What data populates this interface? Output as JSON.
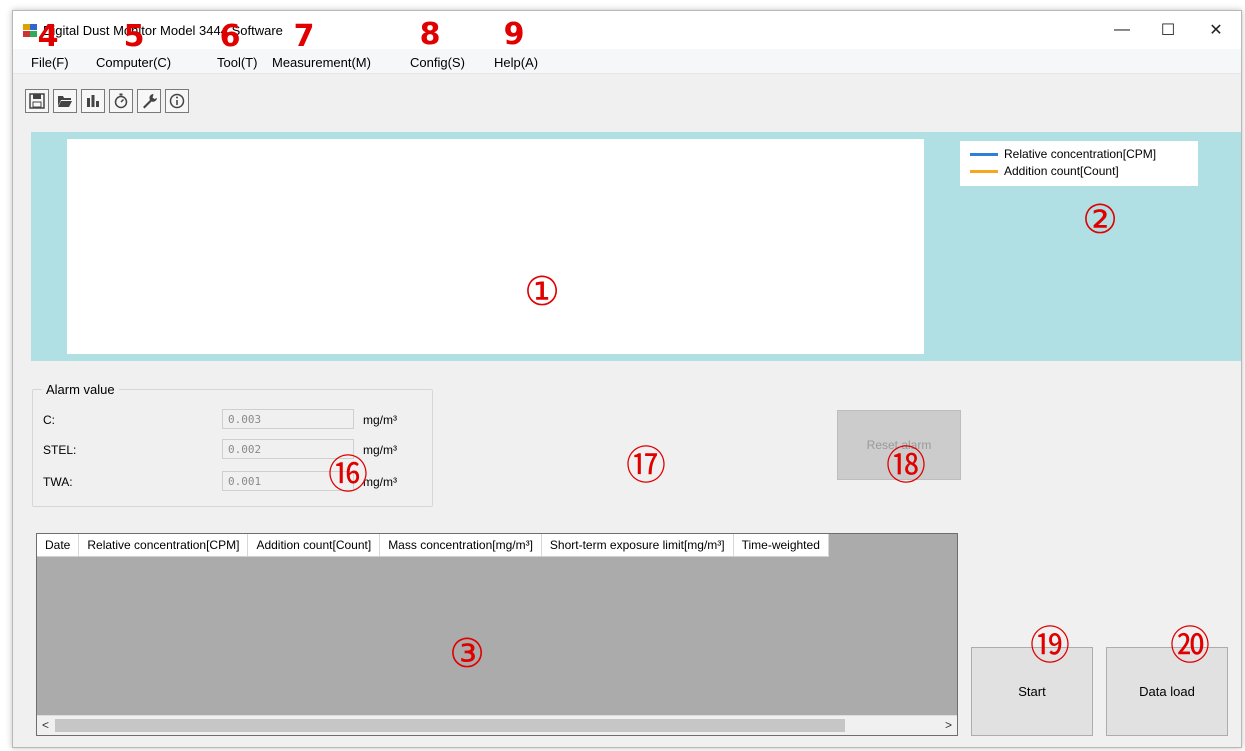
{
  "window": {
    "title": "Digital Dust Monitor Model 3444 Software",
    "minimize": "—",
    "maximize": "☐",
    "close": "✕"
  },
  "menu": [
    "File(F)",
    "Computer(C)",
    "Tool(T)",
    "Measurement(M)",
    "Config(S)",
    "Help(A)"
  ],
  "toolbar": [
    "save-icon",
    "open-folder-icon",
    "bar-chart-icon",
    "stopwatch-icon",
    "wrench-icon",
    "info-icon"
  ],
  "legend": {
    "series1": {
      "label": "Relative concentration[CPM]",
      "color": "#2f7fd8"
    },
    "series2": {
      "label": "Addition count[Count]",
      "color": "#f5a623"
    }
  },
  "alarm": {
    "title": "Alarm value",
    "rows": [
      {
        "label": "C:",
        "value": "0.003",
        "unit": "mg/m³"
      },
      {
        "label": "STEL:",
        "value": "0.002",
        "unit": "mg/m³"
      },
      {
        "label": "TWA:",
        "value": "0.001",
        "unit": "mg/m³"
      }
    ]
  },
  "reset_alarm_label": "Reset alarm",
  "grid": {
    "columns": [
      "Date",
      "Relative concentration[CPM]",
      "Addition count[Count]",
      "Mass concentration[mg/m³]",
      "Short-term exposure limit[mg/m³]",
      "Time-weighted"
    ],
    "scroll_left": "<",
    "scroll_right": ">"
  },
  "buttons": {
    "start": "Start",
    "data_load": "Data load"
  },
  "callouts": [
    "4",
    "5",
    "6",
    "7",
    "8",
    "9",
    "①",
    "②",
    "③",
    "⑯",
    "⑰",
    "⑱",
    "⑲",
    "⑳"
  ]
}
